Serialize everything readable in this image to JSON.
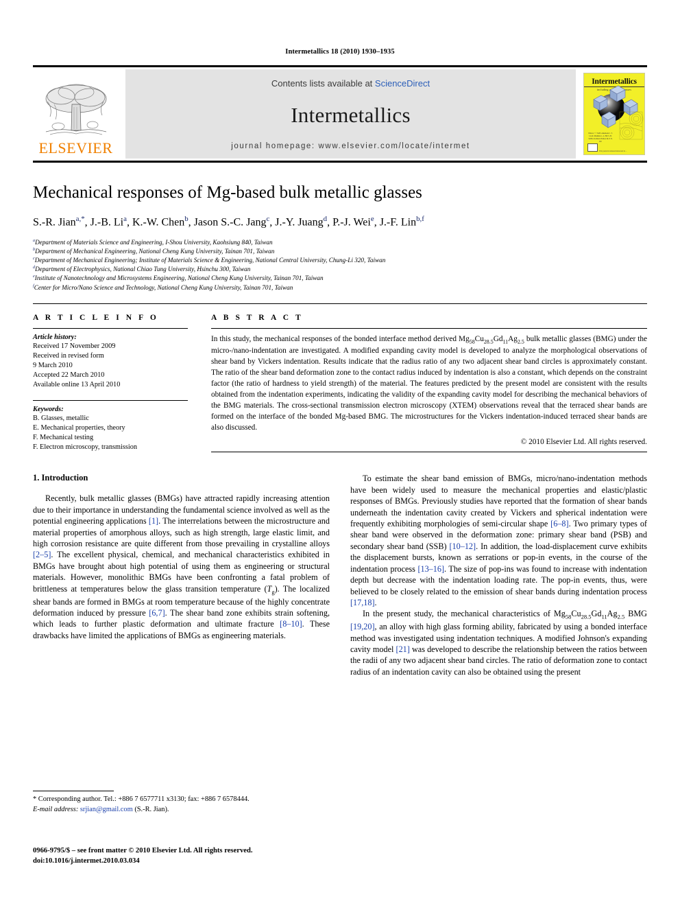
{
  "running_head": "Intermetallics 18 (2010) 1930–1935",
  "masthead": {
    "elsevier_wordmark": "ELSEVIER",
    "contents_prefix": "Contents lists available at ",
    "sciencedirect": "ScienceDirect",
    "journal_title": "Intermetallics",
    "homepage": "journal homepage: www.elsevier.com/locate/intermet",
    "cover": {
      "title": "Intermetallics",
      "subtitle": "including amorphous gasses",
      "editors_block": "Editors\n• • •\nM.H. Alkemade\nC. T. Liu\nR. Mishima\nL.-L. Hill\nS. B. SONG\nTechnical Editors\nM. P. N. P.P.",
      "footer_note": "This journal is indexed/abstracted in ..."
    }
  },
  "article": {
    "title": "Mechanical responses of Mg-based bulk metallic glasses",
    "authors": [
      {
        "name": "S.-R. Jian",
        "sup": "a,*"
      },
      {
        "name": "J.-B. Li",
        "sup": "a"
      },
      {
        "name": "K.-W. Chen",
        "sup": "b"
      },
      {
        "name": "Jason S.-C. Jang",
        "sup": "c"
      },
      {
        "name": "J.-Y. Juang",
        "sup": "d"
      },
      {
        "name": "P.-J. Wei",
        "sup": "e"
      },
      {
        "name": "J.-F. Lin",
        "sup": "b,f"
      }
    ],
    "affiliations": [
      {
        "mark": "a",
        "text": "Department of Materials Science and Engineering, I-Shou University, Kaohsiung 840, Taiwan"
      },
      {
        "mark": "b",
        "text": "Department of Mechanical Engineering, National Cheng Kung University, Tainan 701, Taiwan"
      },
      {
        "mark": "c",
        "text": "Department of Mechanical Engineering; Institute of Materials Science & Engineering, National Central University, Chung-Li 320, Taiwan"
      },
      {
        "mark": "d",
        "text": "Department of Electrophysics, National Chiao Tung University, Hsinchu 300, Taiwan"
      },
      {
        "mark": "e",
        "text": "Institute of Nanotechnology and Microsystems Engineering, National Cheng Kung University, Tainan 701, Taiwan"
      },
      {
        "mark": "f",
        "text": "Center for Micro/Nano Science and Technology, National Cheng Kung University, Tainan 701, Taiwan"
      }
    ]
  },
  "article_info": {
    "heading": "A R T I C L E  I N F O",
    "history_label": "Article history:",
    "history": [
      "Received 17 November 2009",
      "Received in revised form",
      "9 March 2010",
      "Accepted 22 March 2010",
      "Available online 13 April 2010"
    ],
    "keywords_label": "Keywords:",
    "keywords": [
      "B. Glasses, metallic",
      "E. Mechanical properties, theory",
      "F. Mechanical testing",
      "F. Electron microscopy, transmission"
    ]
  },
  "abstract": {
    "heading": "A B S T R A C T",
    "text": "In this study, the mechanical responses of the bonded interface method derived Mg58Cu28.5Gd11Ag2.5 bulk metallic glasses (BMG) under the micro-/nano-indentation are investigated. A modified expanding cavity model is developed to analyze the morphological observations of shear band by Vickers indentation. Results indicate that the radius ratio of any two adjacent shear band circles is approximately constant. The ratio of the shear band deformation zone to the contact radius induced by indentation is also a constant, which depends on the constraint factor (the ratio of hardness to yield strength) of the material. The features predicted by the present model are consistent with the results obtained from the indentation experiments, indicating the validity of the expanding cavity model for describing the mechanical behaviors of the BMG materials. The cross-sectional transmission electron microscopy (XTEM) observations reveal that the terraced shear bands are formed on the interface of the bonded Mg-based BMG. The microstructures for the Vickers indentation-induced terraced shear bands are also discussed.",
    "copyright": "© 2010 Elsevier Ltd. All rights reserved."
  },
  "body": {
    "section_number_title": "1.  Introduction",
    "left_paragraphs": [
      "Recently, bulk metallic glasses (BMGs) have attracted rapidly increasing attention due to their importance in understanding the fundamental science involved as well as the potential engineering applications [1]. The interrelations between the microstructure and material properties of amorphous alloys, such as high strength, large elastic limit, and high corrosion resistance are quite different from those prevailing in crystalline alloys [2–5]. The excellent physical, chemical, and mechanical characteristics exhibited in BMGs have brought about high potential of using them as engineering or structural materials. However, monolithic BMGs have been confronting a fatal problem of brittleness at temperatures below the glass transition temperature (Tg). The localized shear bands are formed in BMGs at room temperature because of the highly concentrate deformation induced by pressure [6,7]. The shear band zone exhibits strain softening, which leads to further plastic deformation and ultimate fracture [8–10]. These drawbacks have limited the applications of BMGs as engineering materials."
    ],
    "right_paragraphs": [
      "To estimate the shear band emission of BMGs, micro/nano-indentation methods have been widely used to measure the mechanical properties and elastic/plastic responses of BMGs. Previously studies have reported that the formation of shear bands underneath the indentation cavity created by Vickers and spherical indentation were frequently exhibiting morphologies of semi-circular shape [6–8]. Two primary types of shear band were observed in the deformation zone: primary shear band (PSB) and secondary shear band (SSB) [10–12]. In addition, the load-displacement curve exhibits the displacement bursts, known as serrations or pop-in events, in the course of the indentation process [13–16]. The size of pop-ins was found to increase with indentation depth but decrease with the indentation loading rate. The pop-in events, thus, were believed to be closely related to the emission of shear bands during indentation process [17,18].",
      "In the present study, the mechanical characteristics of Mg58Cu28.5Gd11Ag2.5 BMG [19,20], an alloy with high glass forming ability, fabricated by using a bonded interface method was investigated using indentation techniques. A modified Johnson's expanding cavity model [21] was developed to describe the relationship between the ratios between the radii of any two adjacent shear band circles. The ratio of deformation zone to contact radius of an indentation cavity can also be obtained using the present"
    ]
  },
  "footnote": {
    "corresponding": "* Corresponding author. Tel.: +886 7 6577711 x3130; fax: +886 7 6578444.",
    "email_label": "E-mail address:",
    "email": "srjian@gmail.com",
    "email_suffix": "(S.-R. Jian)."
  },
  "imprint": {
    "line1": "0966-9795/$ – see front matter © 2010 Elsevier Ltd. All rights reserved.",
    "line2": "doi:10.1016/j.intermet.2010.03.034"
  },
  "colors": {
    "link_blue": "#1a3faa",
    "sd_blue": "#2b5eb8",
    "elsevier_orange": "#f08000",
    "banner_gray": "#e3e3e3",
    "cover_yellow": "#f2ef28"
  }
}
